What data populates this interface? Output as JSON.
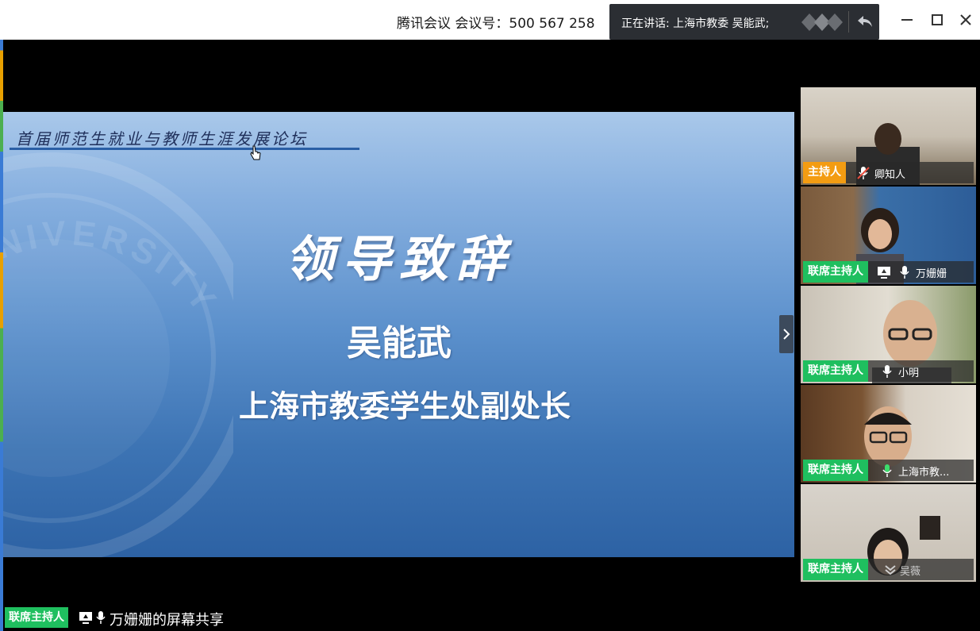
{
  "titlebar": {
    "meeting_title": "腾讯会议 会议号：500 567 258",
    "speaking": "正在讲话: 上海市教委 吴能武;"
  },
  "slide": {
    "header": "首届师范生就业与教师生涯发展论坛",
    "main_title": "领导致辞",
    "speaker_name": "吴能武",
    "speaker_role": "上海市教委学生处副处长",
    "watermark": "MAL UNIVERSITY"
  },
  "participants": [
    {
      "role": "主持人",
      "name": "卿知人",
      "role_type": "host",
      "mic": "muted"
    },
    {
      "role": "联席主持人",
      "name": "万姗姗",
      "role_type": "cohost",
      "mic": "on",
      "sharing": true
    },
    {
      "role": "联席主持人",
      "name": "小明",
      "role_type": "cohost",
      "mic": "on"
    },
    {
      "role": "联席主持人",
      "name": "上海市教...",
      "role_type": "cohost",
      "mic": "speaking"
    },
    {
      "role": "联席主持人",
      "name": "吴薇",
      "role_type": "cohost",
      "mic": "off"
    }
  ],
  "share_bar": {
    "role": "联席主持人",
    "text": "万姗姗的屏幕共享"
  },
  "colors": {
    "host": "#f39c12",
    "cohost": "#1fbf5f",
    "speaking_mic": "#3ddc6c"
  }
}
